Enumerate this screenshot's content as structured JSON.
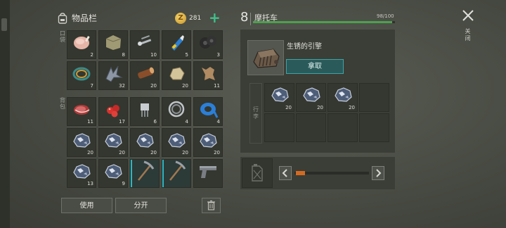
{
  "inventory": {
    "title": "物品栏",
    "coins": "281",
    "pockets_label": "口袋",
    "backpack_label": "背包",
    "slots": [
      {
        "icon": "raw-chicken-icon",
        "count": "2"
      },
      {
        "icon": "cloth-bundle-icon",
        "count": "8"
      },
      {
        "icon": "nails-icon",
        "count": "10"
      },
      {
        "icon": "glue-tube-icon",
        "count": "5"
      },
      {
        "icon": "tires-icon",
        "count": "3"
      },
      {
        "icon": "wire-coil-icon",
        "count": "7"
      },
      {
        "icon": "scrap-metal-icon",
        "count": "32"
      },
      {
        "icon": "log-icon",
        "count": "20"
      },
      {
        "icon": "stone-icon",
        "count": "20"
      },
      {
        "icon": "leather-hide-icon",
        "count": "11"
      },
      {
        "icon": "raw-meat-icon",
        "count": "11"
      },
      {
        "icon": "berries-icon",
        "count": "17"
      },
      {
        "icon": "electronic-part-icon",
        "count": "6"
      },
      {
        "icon": "bearing-icon",
        "count": "4"
      },
      {
        "icon": "duct-tape-icon",
        "count": "4"
      },
      {
        "icon": "iron-ore-icon",
        "count": "20"
      },
      {
        "icon": "iron-ore-icon",
        "count": "20"
      },
      {
        "icon": "iron-ore-icon",
        "count": "20"
      },
      {
        "icon": "iron-ore-icon",
        "count": "20"
      },
      {
        "icon": "iron-ore-icon",
        "count": "20"
      },
      {
        "icon": "iron-ore-icon",
        "count": "13"
      },
      {
        "icon": "iron-ore-icon",
        "count": "9"
      },
      {
        "icon": "pickaxe-icon",
        "count": ""
      },
      {
        "icon": "pickaxe-icon",
        "count": ""
      },
      {
        "icon": "pistol-icon",
        "count": ""
      }
    ],
    "use_button": "使用",
    "split_button": "分开"
  },
  "vehicle": {
    "level": "8",
    "name": "摩托车",
    "hp_text": "98/100",
    "hp_fraction": 0.98,
    "engine_name": "生锈的引擎",
    "take_button": "拿取",
    "trunk_label": "行李",
    "trunk_slots": [
      {
        "icon": "iron-ore-icon",
        "count": "20"
      },
      {
        "icon": "iron-ore-icon",
        "count": "20"
      },
      {
        "icon": "iron-ore-icon",
        "count": "20"
      },
      {
        "icon": "",
        "count": ""
      },
      {
        "icon": "",
        "count": ""
      },
      {
        "icon": "",
        "count": ""
      },
      {
        "icon": "",
        "count": ""
      },
      {
        "icon": "",
        "count": ""
      }
    ],
    "fuel_fraction": 0.12
  },
  "close_label": "关闭",
  "colors": {
    "accent": "#3fbf8c",
    "take": "#2b5a5a",
    "hp": "#4da04f",
    "fuel": "#d46a21",
    "tool": "#2bb6c2"
  }
}
